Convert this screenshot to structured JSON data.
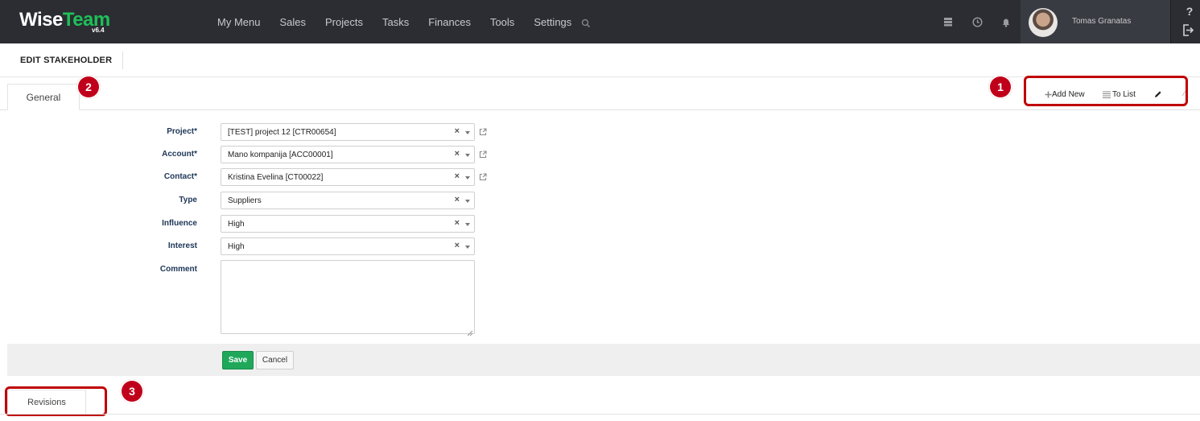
{
  "app": {
    "logo_wise": "Wise",
    "logo_team": "Team",
    "version": "v6.4"
  },
  "nav": {
    "items": [
      "My Menu",
      "Sales",
      "Projects",
      "Tasks",
      "Finances",
      "Tools",
      "Settings"
    ]
  },
  "user": {
    "name": "Tomas Granatas"
  },
  "help": {
    "label": "?"
  },
  "page": {
    "title": "EDIT STAKEHOLDER"
  },
  "tabs": {
    "general": "General",
    "revisions": "Revisions"
  },
  "toolbar": {
    "add_new": "Add New",
    "to_list": "To List"
  },
  "annotations": {
    "one": "1",
    "two": "2",
    "three": "3"
  },
  "form": {
    "project": {
      "label": "Project*",
      "value": "[TEST] project 12 [CTR00654]"
    },
    "account": {
      "label": "Account*",
      "value": "Mano kompanija [ACC00001]"
    },
    "contact": {
      "label": "Contact*",
      "value": "Kristina Evelina [CT00022]"
    },
    "type": {
      "label": "Type",
      "value": "Suppliers"
    },
    "influence": {
      "label": "Influence",
      "value": "High"
    },
    "interest": {
      "label": "Interest",
      "value": "High"
    },
    "comment": {
      "label": "Comment",
      "value": ""
    },
    "clear_glyph": "×"
  },
  "actions": {
    "save": "Save",
    "cancel": "Cancel"
  },
  "colors": {
    "navbar": "#2b2d33",
    "brand_green": "#1fbf59",
    "save_green": "#1fa85a",
    "annotation_red": "#c00000",
    "label_blue": "#1d3557"
  }
}
